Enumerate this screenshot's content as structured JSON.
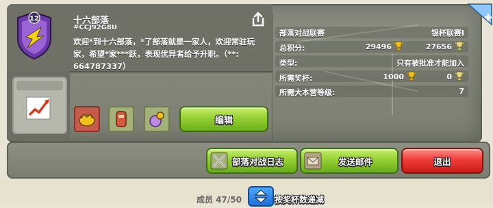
{
  "clan": {
    "level": "12",
    "name": "十六部落",
    "tag": "#CCJ92G8U",
    "description": "欢迎*到十六部落，*了部落就是一家人，欢迎常驻玩家，希望*家***跃，表现优异者给予升职。（**: 664787337）"
  },
  "stats": {
    "war_league_label": "部落对战联赛",
    "war_league_value": "银杯联赛I",
    "total_points_label": "总积分:",
    "total_points_home": "29496",
    "total_points_builder": "27656",
    "type_label": "类型:",
    "type_value": "只有被批准才能加入",
    "required_trophies_label": "所需奖杯:",
    "required_trophies_home": "1000",
    "required_trophies_builder": "0",
    "required_th_label": "所需大本营等级:",
    "required_th_value": "7"
  },
  "buttons": {
    "edit": "编辑",
    "war_log": "部落对战日志",
    "send_mail": "发送邮件",
    "leave": "退出"
  },
  "footer": {
    "members": "成员 47/50",
    "sort_label": "按奖杯数递减"
  },
  "icons": {
    "share": "share-icon",
    "trend": "trend-chart-icon",
    "war_log": "crossed-swords-icon",
    "mail": "mail-icon",
    "sort": "sort-arrows-icon"
  },
  "colors": {
    "green_button": "#95cf33",
    "red_button": "#ef3d38",
    "panel": "#7c7f72",
    "trophy_gold": "#f2c21a"
  }
}
